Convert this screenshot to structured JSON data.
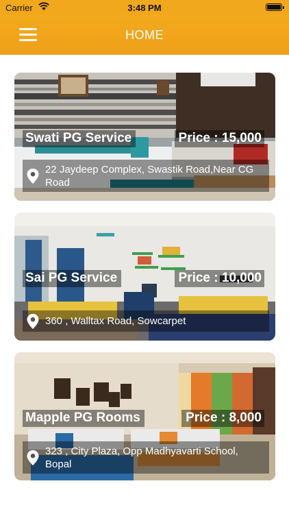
{
  "status_bar": {
    "carrier": "Carrier",
    "time": "3:48 PM"
  },
  "nav": {
    "title": "HOME",
    "menu_icon": "hamburger-menu-icon"
  },
  "listings": [
    {
      "name": "Swati PG Service",
      "price": "Price : 15,000",
      "address": "22  Jaydeep Complex, Swastik Road,Near CG Road"
    },
    {
      "name": "Sai PG Service",
      "price": "Price : 10,000",
      "address": "360 , Walltax Road, Sowcarpet"
    },
    {
      "name": "Mapple PG Rooms",
      "price": "Price : 8,000",
      "address": "323 , City Plaza, Opp Madhyavarti School, Bopal"
    }
  ],
  "colors": {
    "nav": "#f2a81d",
    "nav_text": "#ffffff",
    "overlay": "#000000"
  }
}
